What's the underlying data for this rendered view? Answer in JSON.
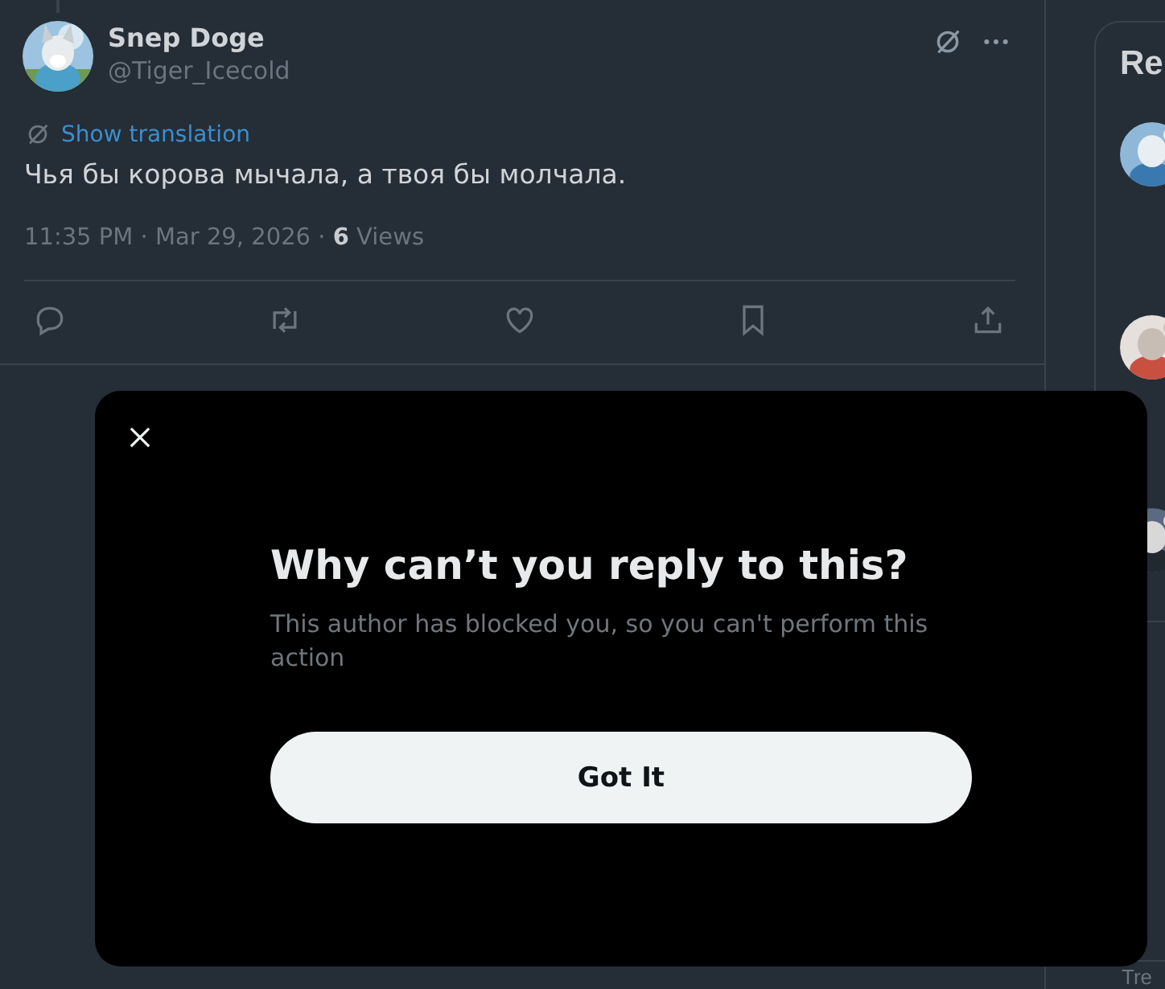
{
  "tweet": {
    "author": {
      "name": "Snep Doge",
      "handle": "@Tiger_Icecold"
    },
    "translate_link": "Show translation",
    "text": "Чья бы корова мычала, а твоя бы молчала.",
    "meta": "11:35 PM · Mar 29, 2026 · **6** Views",
    "actions": [
      {
        "kind": "reply"
      },
      {
        "kind": "repost"
      },
      {
        "kind": "like"
      },
      {
        "kind": "bookmark"
      },
      {
        "kind": "share"
      }
    ]
  },
  "sidebar": {
    "card_title": "Re",
    "footer": "Tre"
  },
  "dialog": {
    "title": "Why can’t you reply to this?",
    "message": "This author has blocked you, so you can't perform this action",
    "button": "Got It"
  }
}
